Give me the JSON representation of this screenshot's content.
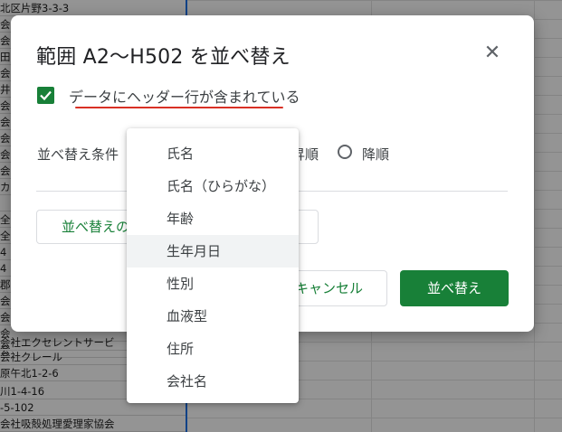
{
  "background_sheet": {
    "rows": [
      "北区片野3-3-3",
      "会",
      "会",
      "田",
      "会",
      "井",
      "会",
      "会",
      "会",
      "会",
      "会",
      "カ",
      "",
      "全",
      "全",
      "4",
      "4",
      "郡",
      "会",
      "会",
      "会",
      "会",
      "会社エクセレントサービ",
      "会社クレール",
      "原午北1-2-6",
      "川1-4-16",
      "-5-102",
      "会社吸殻処理愛理家協会"
    ]
  },
  "dialog": {
    "title": "範囲 A2〜H502 を並べ替え",
    "close_icon": "✕",
    "header_checkbox": {
      "checked": true,
      "label": "データにヘッダー行が含まれている"
    },
    "sort_condition_label": "並べ替え条件",
    "order": {
      "ascending_label": "昇順",
      "descending_label": "降順"
    },
    "add_sort_column_label": "並べ替えの",
    "cancel_label": "キャンセル",
    "sort_label": "並べ替え"
  },
  "dropdown": {
    "items": [
      "氏名",
      "氏名（ひらがな）",
      "年齢",
      "生年月日",
      "性別",
      "血液型",
      "住所",
      "会社名"
    ],
    "highlighted_index": 3
  },
  "colors": {
    "accent_green": "#188038",
    "underline_red": "#d93025"
  }
}
